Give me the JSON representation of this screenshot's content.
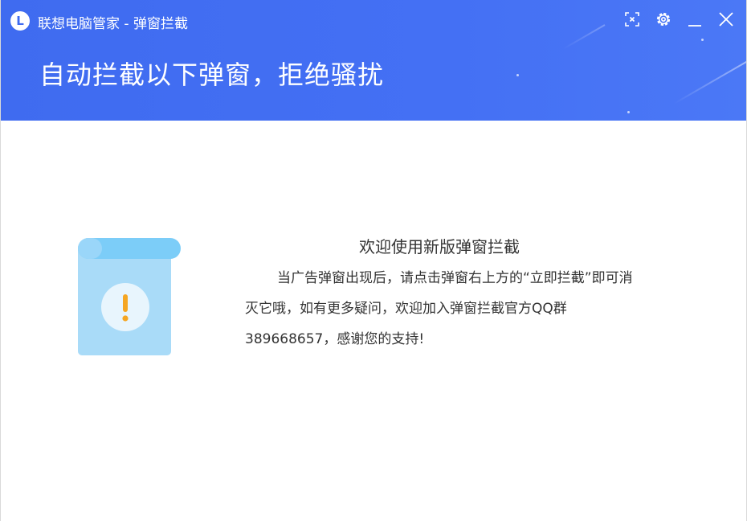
{
  "window": {
    "app_logo_letter": "L",
    "title": "联想电脑管家 - 弹窗拦截",
    "controls": {
      "screenshot_icon": "screenshot-icon",
      "settings_icon": "gear-icon",
      "minimize_icon": "minimize-icon",
      "close_icon": "close-icon"
    }
  },
  "header": {
    "headline": "自动拦截以下弹窗，拒绝骚扰"
  },
  "message": {
    "title": "欢迎使用新版弹窗拦截",
    "body": "当广告弹窗出现后，请点击弹窗右上方的“立即拦截”即可消灭它哦，如有更多疑问，欢迎加入弹窗拦截官方QQ群 389668657，感谢您的支持!",
    "illustration_icon": "warning-scroll-icon",
    "warning_symbol": "!"
  },
  "colors": {
    "header_blue": "#4470f4",
    "scroll_light": "#a9dbf8",
    "scroll_top": "#7ccdf8",
    "warning_orange": "#f5a623",
    "text_dark": "#333333"
  }
}
